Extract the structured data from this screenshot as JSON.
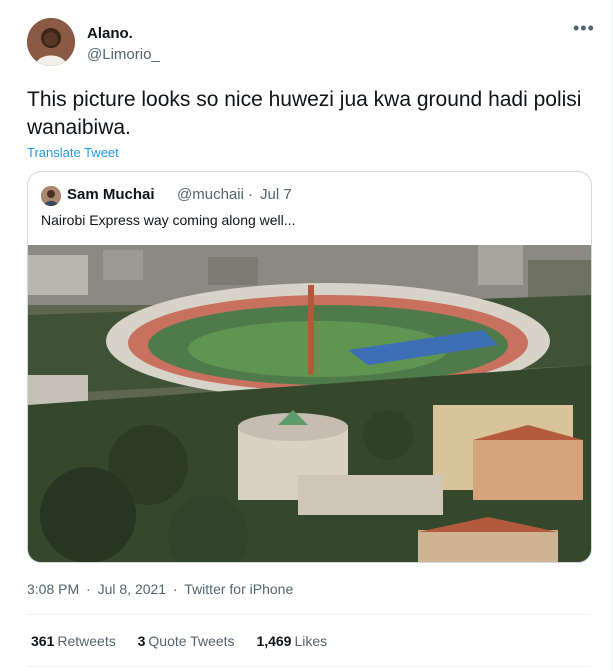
{
  "tweet": {
    "author_name": "Alano.",
    "author_handle": "@Limorio_",
    "more_icon": "more-horizontal-icon",
    "text": "This picture looks so nice huwezi jua kwa ground hadi polisi wanaibiwa.",
    "translate_label": "Translate Tweet"
  },
  "quote": {
    "author_name": "Sam Muchai",
    "author_handle": "@muchaii",
    "separator": "·",
    "date": "Jul 7",
    "text": "Nairobi Express way coming along well..."
  },
  "meta": {
    "time": "3:08 PM",
    "sep1": "·",
    "date": "Jul 8, 2021",
    "sep2": "·",
    "source": "Twitter for iPhone"
  },
  "stats": {
    "retweets_count": "361",
    "retweets_label": "Retweets",
    "quotes_count": "3",
    "quotes_label": "Quote Tweets",
    "likes_count": "1,469",
    "likes_label": "Likes"
  },
  "colors": {
    "link": "#1d9bf0",
    "secondary_text": "#536471",
    "border": "#cfd9de"
  }
}
